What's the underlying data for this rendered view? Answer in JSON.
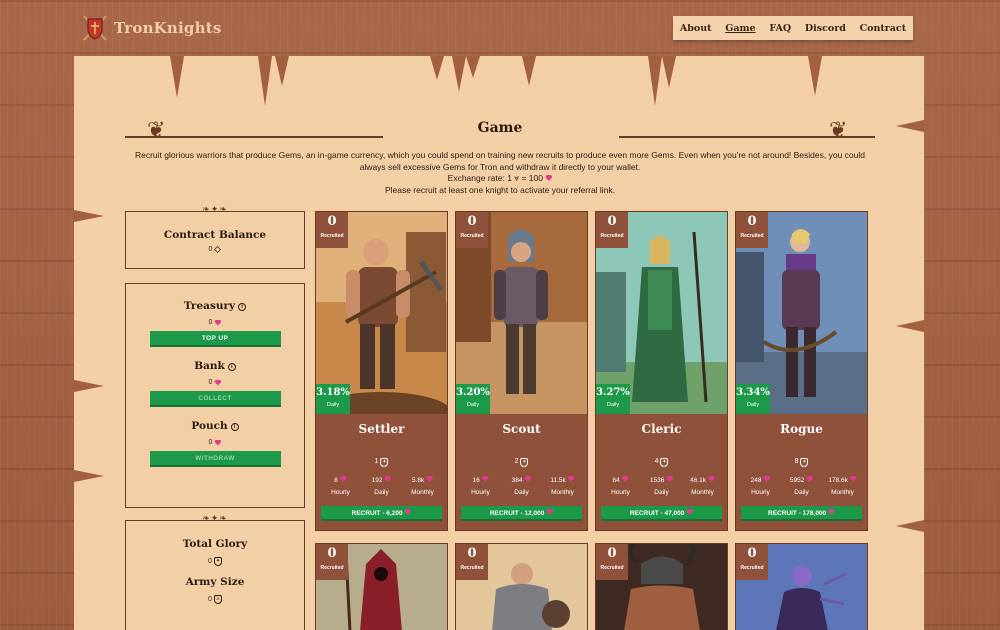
{
  "app": {
    "name": "TronKnights"
  },
  "nav": [
    {
      "label": "About",
      "active": false
    },
    {
      "label": "Game",
      "active": true
    },
    {
      "label": "FAQ",
      "active": false
    },
    {
      "label": "Discord",
      "active": false
    },
    {
      "label": "Contract",
      "active": false
    }
  ],
  "page": {
    "title": "Game",
    "intro_line1": "Recruit glorious warriors that produce Gems, an in-game currency, which you could spend on training new recruits to produce even more Gems. Even when you're not around! Besides, you could",
    "intro_line2": "always sell excessive Gems for Tron and withdraw it directly to your wallet.",
    "exchange_rate": "Exchange rate: 1 ⩔ = 100",
    "referral_note": "Please recruit at least one knight to activate your referral link."
  },
  "sidebar": {
    "contract_balance": {
      "title": "Contract Balance",
      "value": "0"
    },
    "treasury": {
      "title": "Treasury",
      "value": "0",
      "button": "TOP UP"
    },
    "bank": {
      "title": "Bank",
      "value": "0",
      "button": "COLLECT"
    },
    "pouch": {
      "title": "Pouch",
      "value": "0",
      "button": "WITHDRAW"
    },
    "total_glory": {
      "title": "Total Glory",
      "value": "0"
    },
    "army_size": {
      "title": "Army Size",
      "value": "0"
    }
  },
  "labels": {
    "recruited": "Recruited",
    "daily": "Daily",
    "hourly": "Hourly",
    "monthly": "Monthly"
  },
  "cards": [
    {
      "level": "0",
      "rate": "3.18%",
      "name": "Settler",
      "glory": "1",
      "hourly": "8",
      "daily": "192",
      "monthly": "5.8k",
      "recruit": "RECRUIT - 6,200"
    },
    {
      "level": "0",
      "rate": "3.20%",
      "name": "Scout",
      "glory": "2",
      "hourly": "16",
      "daily": "384",
      "monthly": "11.5k",
      "recruit": "RECRUIT - 12,000"
    },
    {
      "level": "0",
      "rate": "3.27%",
      "name": "Cleric",
      "glory": "4",
      "hourly": "64",
      "daily": "1536",
      "monthly": "46.1k",
      "recruit": "RECRUIT - 47,000"
    },
    {
      "level": "0",
      "rate": "3.34%",
      "name": "Rogue",
      "glory": "8",
      "hourly": "248",
      "daily": "5952",
      "monthly": "178.6k",
      "recruit": "RECRUIT - 178,000"
    }
  ],
  "cards_row2": [
    {
      "level": "0"
    },
    {
      "level": "0"
    },
    {
      "level": "0"
    },
    {
      "level": "0"
    }
  ],
  "colors": {
    "wood": "#a3603f",
    "parchment": "#f3cfa5",
    "accent_green": "#1d9a49",
    "card_brown": "#8f5139",
    "gem": "#e03c8c"
  }
}
